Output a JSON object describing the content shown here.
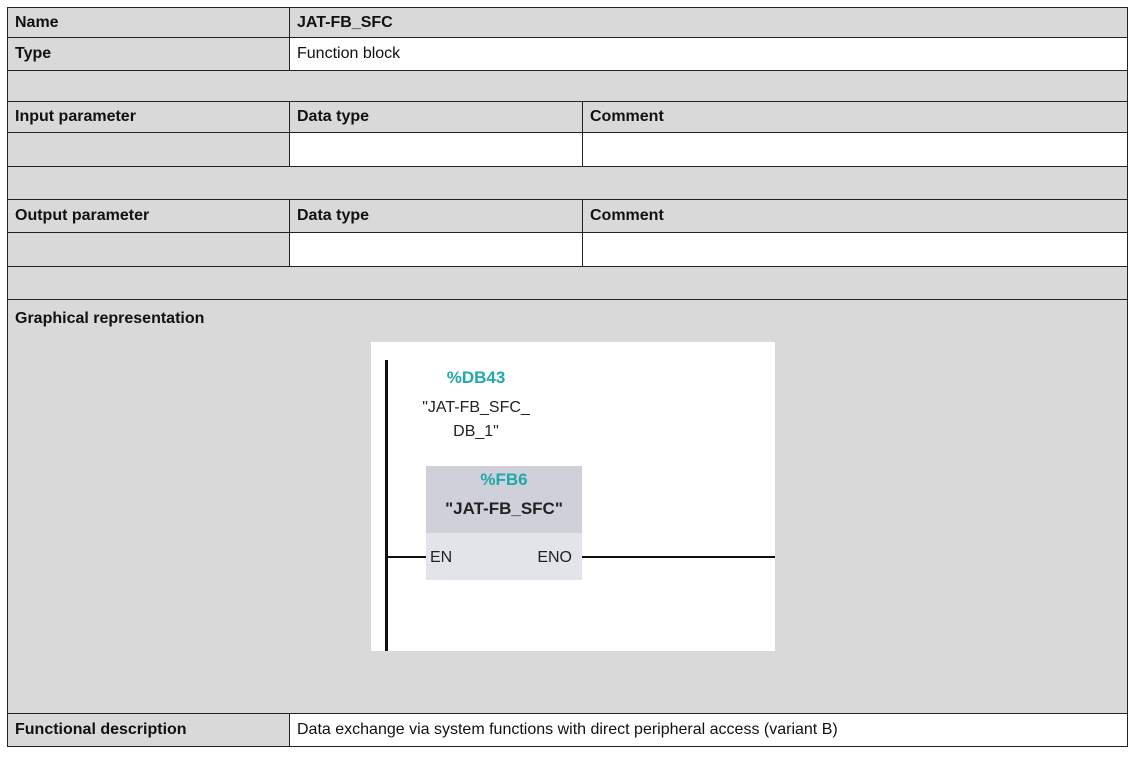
{
  "name": {
    "label": "Name",
    "value": "JAT-FB_SFC"
  },
  "type": {
    "label": "Type",
    "value": "Function block"
  },
  "inputs": {
    "headers": [
      "Input parameter",
      "Data type",
      "Comment"
    ]
  },
  "outputs": {
    "headers": [
      "Output parameter",
      "Data type",
      "Comment"
    ]
  },
  "graphical": {
    "label": "Graphical representation",
    "db_address": "%DB43",
    "db_name_line1": "\"JAT-FB_SFC_",
    "db_name_line2": "DB_1\"",
    "fb_address": "%FB6",
    "fb_name": "\"JAT-FB_SFC\"",
    "pin_en": "EN",
    "pin_eno": "ENO"
  },
  "functional": {
    "label": "Functional description",
    "value": "Data exchange via system functions with direct peripheral access (variant B)"
  }
}
